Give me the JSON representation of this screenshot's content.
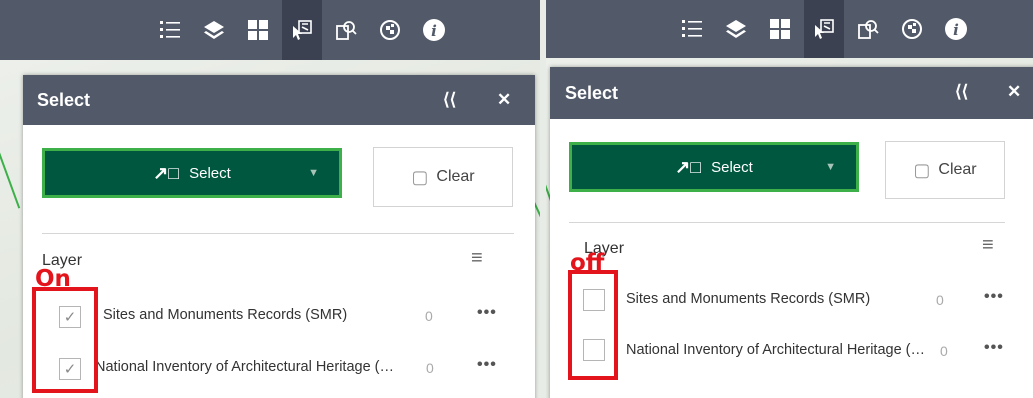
{
  "toolbar": {
    "icons": [
      "legend-icon",
      "layers-icon",
      "basemap-gallery-icon",
      "select-icon",
      "query-icon",
      "analysis-icon",
      "about-icon"
    ]
  },
  "left_panel": {
    "title": "Select",
    "select_button_label": "Select",
    "clear_button_label": "Clear",
    "layer_label": "Layer",
    "annotation": "On",
    "rows": [
      {
        "label": "Sites and Monuments Records (SMR)",
        "count": "0",
        "checked": true
      },
      {
        "label": "National Inventory of Architectural Heritage (…",
        "count": "0",
        "checked": true
      }
    ]
  },
  "right_panel": {
    "title": "Select",
    "select_button_label": "Select",
    "clear_button_label": "Clear",
    "layer_label": "Layer",
    "annotation": "off",
    "rows": [
      {
        "label": "Sites and Monuments Records (SMR)",
        "count": "0",
        "checked": false
      },
      {
        "label": "National Inventory of Architectural Heritage (…",
        "count": "0",
        "checked": false
      }
    ]
  },
  "colors": {
    "header": "#525a69",
    "select_button": "#00573f",
    "select_button_border": "#3db04a",
    "annotation_red": "#e3141c"
  }
}
